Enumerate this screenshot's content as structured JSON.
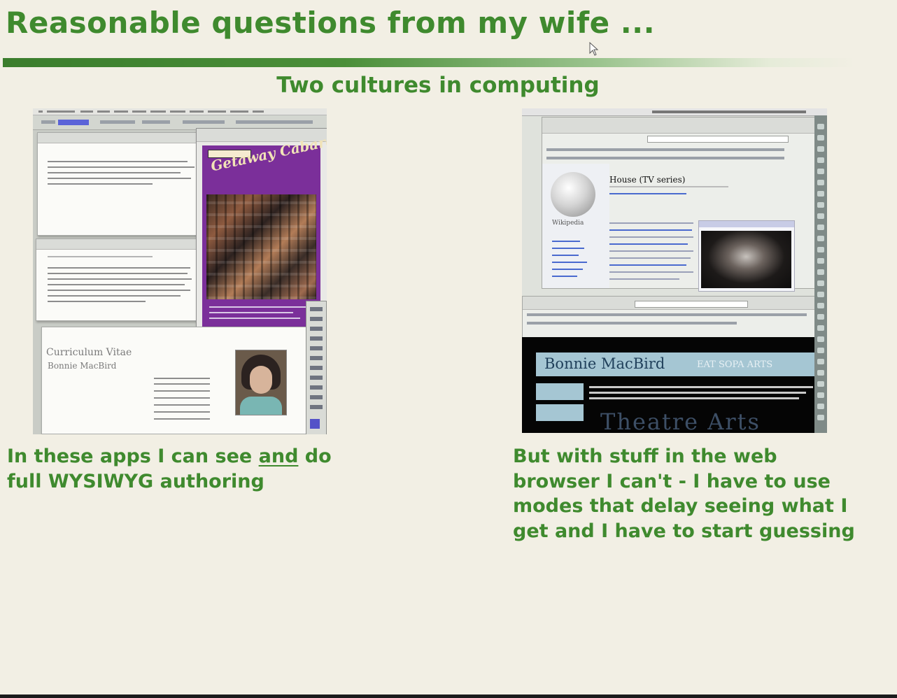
{
  "slide": {
    "title": "Reasonable questions from my wife ...",
    "subtitle": "Two cultures in computing"
  },
  "left_screenshot": {
    "cv_title": "Curriculum Vitae",
    "cv_name": "Bonnie MacBird",
    "poster_text": "Getaway Cabaret"
  },
  "right_screenshot": {
    "wiki_logo_text": "Wikipedia",
    "wiki_article_title": "House (TV series)",
    "site_title": "Bonnie MacBird",
    "site_tagline": "EAT SOPA ARTS",
    "site_heading": "Theatre Arts"
  },
  "captions": {
    "left_before": "In these apps I can see ",
    "left_underlined": "and",
    "left_after": " do",
    "left_line2": "full WYSIWYG authoring",
    "right_line1": "But with stuff in the web",
    "right_line2": "browser I can't - I have to use",
    "right_line3": "modes that delay seeing what I",
    "right_line4": "get and I have to start guessing"
  },
  "colors": {
    "background": "#f2efe4",
    "accent_green": "#3f8a2e",
    "rule_green": "#3b7d2c"
  }
}
